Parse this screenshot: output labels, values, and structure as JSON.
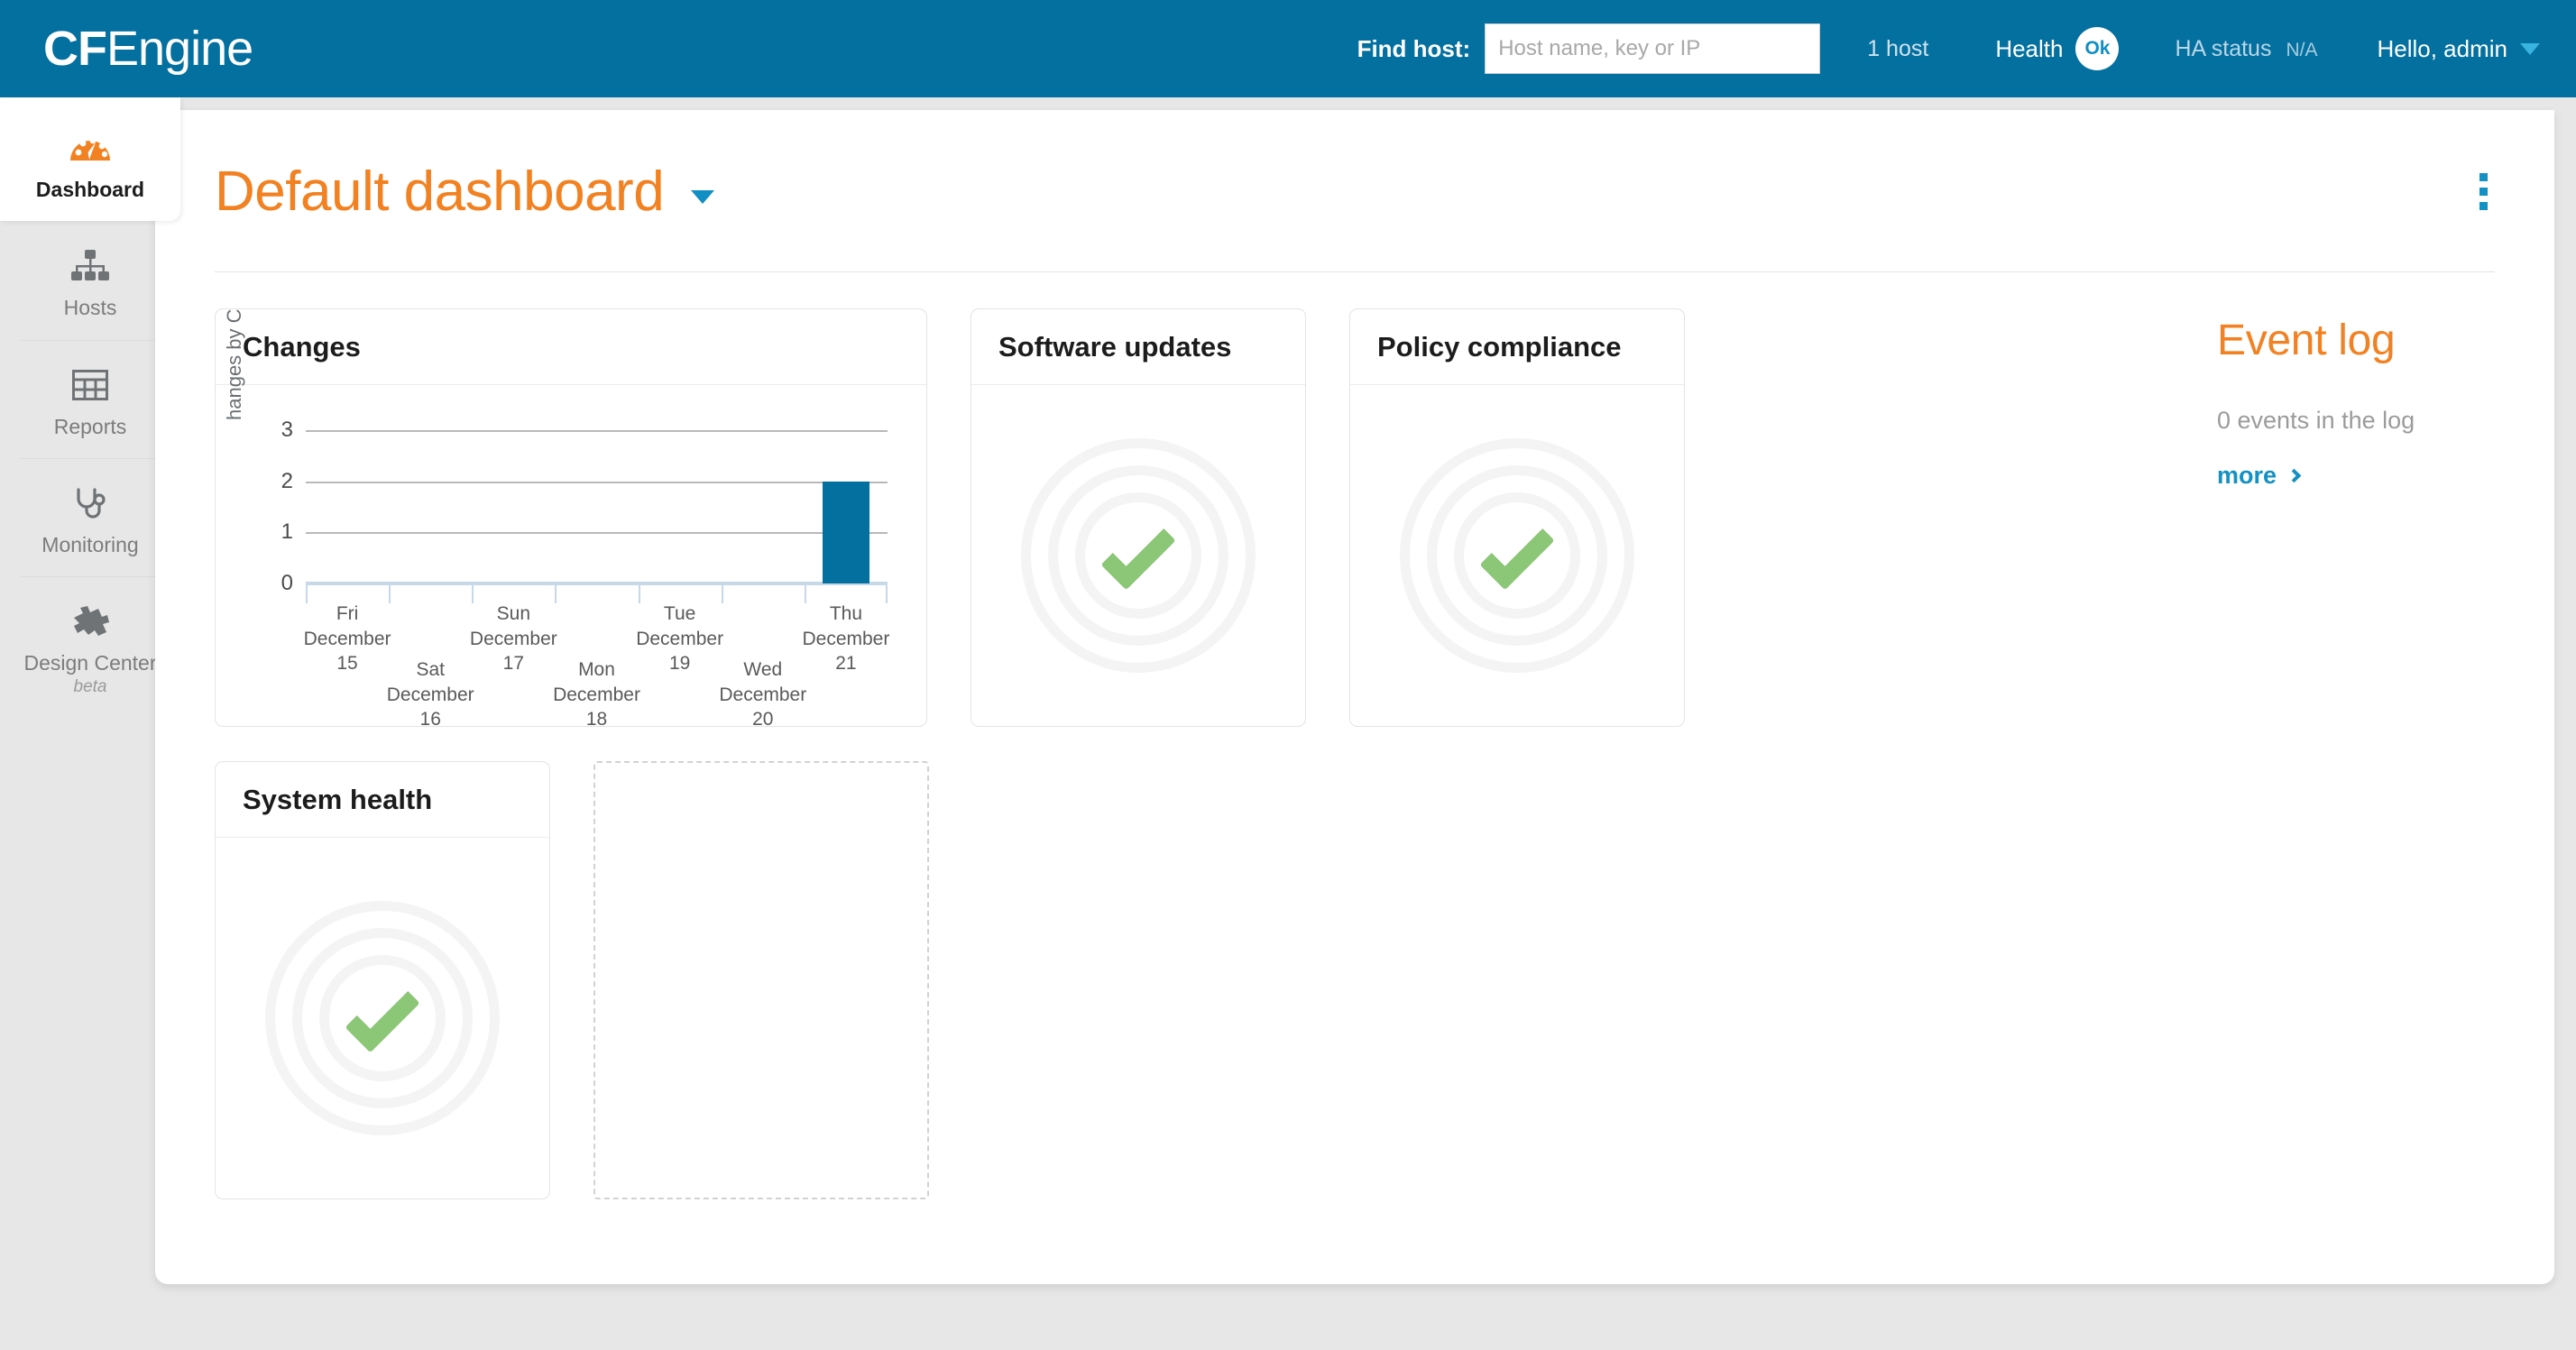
{
  "header": {
    "logo_bold": "CF",
    "logo_rest": "Engine",
    "find_host_label": "Find host:",
    "host_input_placeholder": "Host name, key or IP",
    "host_input_value": "",
    "host_count": "1 host",
    "health_label": "Health",
    "health_status": "Ok",
    "ha_label": "HA status",
    "ha_value": "N/A",
    "user_label": "Hello, admin",
    "caret_icon": "chevron-down-icon",
    "bg_color": "#04709f"
  },
  "sidebar": {
    "items": [
      {
        "label": "Dashboard",
        "icon": "gauge-icon",
        "active": true
      },
      {
        "label": "Hosts",
        "icon": "sitemap-icon",
        "active": false
      },
      {
        "label": "Reports",
        "icon": "table-icon",
        "active": false
      },
      {
        "label": "Monitoring",
        "icon": "stethoscope-icon",
        "active": false
      },
      {
        "label": "Design Center",
        "icon": "puzzle-piece-icon",
        "active": false,
        "badge": "beta"
      }
    ]
  },
  "page": {
    "title": "Default dashboard",
    "title_caret_icon": "chevron-down-icon",
    "menu_icon": "kebab-menu-icon",
    "accent_orange": "#f28121",
    "accent_blue": "#1490c2"
  },
  "widgets": [
    {
      "id": "changes",
      "title": "Changes",
      "type": "bar-chart"
    },
    {
      "id": "software-updates",
      "title": "Software updates",
      "type": "ring-gauge",
      "status_icon": "check-icon"
    },
    {
      "id": "policy-compliance",
      "title": "Policy compliance",
      "type": "ring-gauge",
      "status_icon": "check-icon"
    },
    {
      "id": "system-health",
      "title": "System health",
      "type": "ring-gauge",
      "status_icon": "check-icon"
    }
  ],
  "event_log": {
    "title": "Event log",
    "count_text": "0 events in the log",
    "more_label": "more",
    "more_icon": "chevron-right-icon"
  },
  "chart_data": {
    "type": "bar",
    "title": "Changes",
    "xlabel": "",
    "ylabel": "Changes by CFEngi",
    "categories": [
      "Fri\nDecember\n15",
      "Sat\nDecember\n16",
      "Sun\nDecember\n17",
      "Mon\nDecember\n18",
      "Tue\nDecember\n19",
      "Wed\nDecember\n20",
      "Thu\nDecember\n21"
    ],
    "values": [
      0,
      0,
      0,
      0,
      0,
      0,
      2
    ],
    "yticks": [
      0,
      1,
      2,
      3
    ],
    "ylim": [
      0,
      3
    ],
    "grid": true,
    "legend": false,
    "bar_color": "#04709f"
  }
}
